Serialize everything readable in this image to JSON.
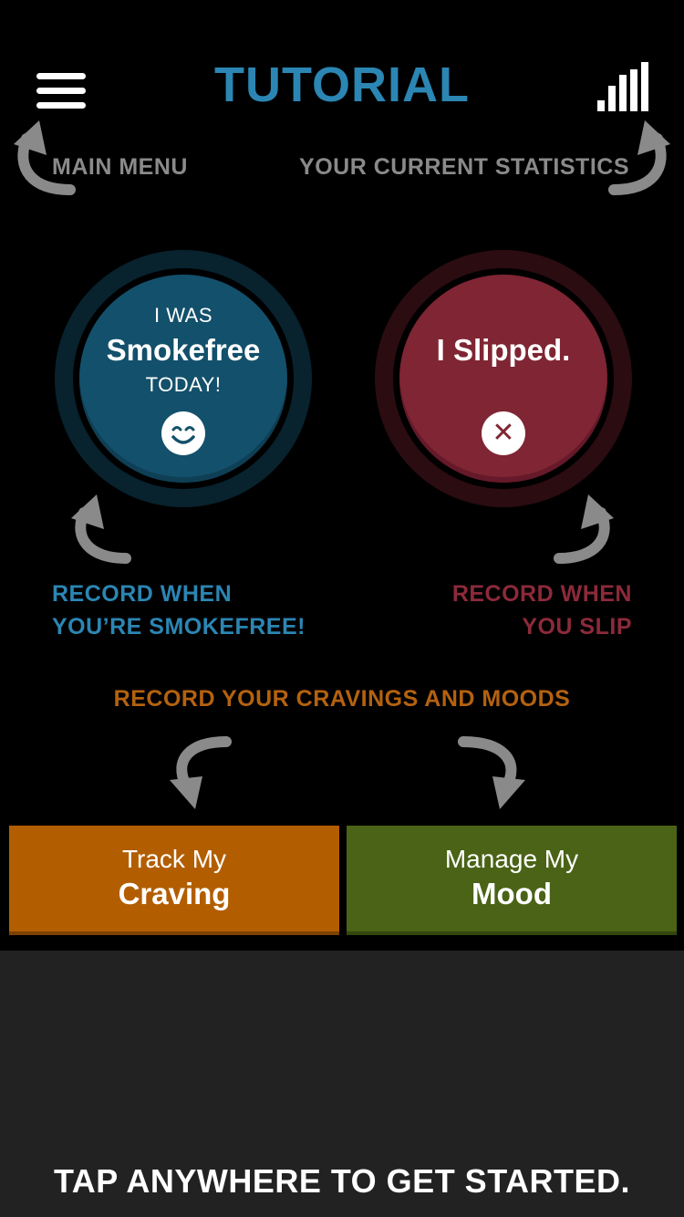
{
  "header": {
    "title": "TUTORIAL",
    "menu_icon": "hamburger-menu-icon",
    "stats_icon": "bar-chart-icon"
  },
  "hints": {
    "main_menu": "MAIN MENU",
    "statistics": "YOUR CURRENT STATISTICS"
  },
  "smokefree_button": {
    "line1": "I WAS",
    "line2": "Smokefree",
    "line3": "TODAY!",
    "icon": "smiley-face-icon"
  },
  "slipped_button": {
    "label": "I Slipped.",
    "icon": "close-x-icon"
  },
  "record": {
    "smokefree_line1": "RECORD WHEN",
    "smokefree_line2": "YOU’RE SMOKEFREE!",
    "slip_line1": "RECORD WHEN",
    "slip_line2": "YOU SLIP",
    "cravings": "RECORD YOUR CRAVINGS AND MOODS"
  },
  "buttons": {
    "craving_small": "Track My",
    "craving_big": "Craving",
    "mood_small": "Manage My",
    "mood_big": "Mood"
  },
  "footer": {
    "tap_text": "TAP ANYWHERE TO GET STARTED."
  },
  "colors": {
    "blue": "#2b86b3",
    "red": "#8c2a3a",
    "orange": "#b25e00",
    "green": "#4a6317",
    "arrow_gray": "#8a8a8a"
  }
}
